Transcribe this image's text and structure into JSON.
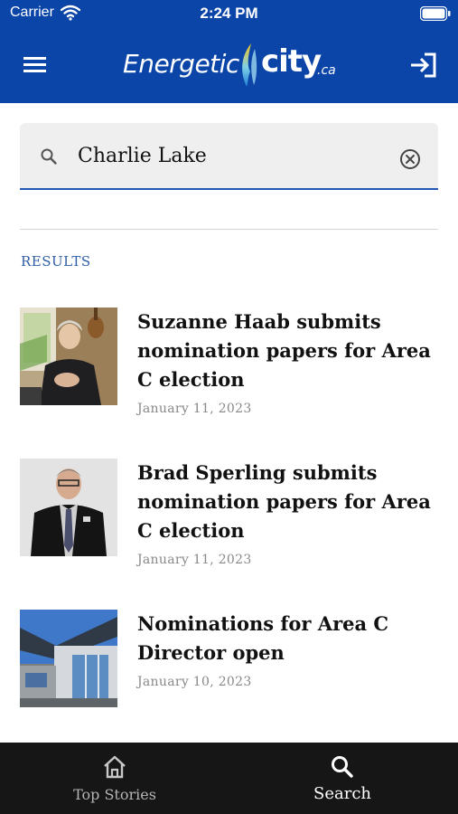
{
  "status_bar": {
    "carrier": "Carrier",
    "time": "2:24 PM",
    "wifi_icon": "wifi-icon",
    "battery_icon": "battery-icon"
  },
  "app_bar": {
    "menu_icon": "hamburger-menu-icon",
    "login_icon": "login-icon",
    "logo": {
      "word": "Energetic",
      "city": "city",
      "tld": ".ca"
    },
    "background_color": "#0b45a8"
  },
  "search": {
    "value": "Charlie Lake",
    "icon": "search-icon",
    "clear_icon": "clear-circle-icon",
    "underline_color": "#2359b5"
  },
  "results": {
    "heading": "RESULTS",
    "items": [
      {
        "title": "Suzanne Haab submits nomination papers for Area C election",
        "date": "January 11, 2023",
        "thumbnail": "portrait-woman-with-guitar"
      },
      {
        "title": "Brad Sperling submits nomination papers for Area C election",
        "date": "January 11, 2023",
        "thumbnail": "portrait-man-in-suit"
      },
      {
        "title": "Nominations for Area C Director open",
        "date": "January 10, 2023",
        "thumbnail": "municipal-building"
      }
    ]
  },
  "tab_bar": {
    "tabs": [
      {
        "label": "Top Stories",
        "icon": "home-icon",
        "active": false
      },
      {
        "label": "Search",
        "icon": "search-icon",
        "active": true
      }
    ]
  }
}
